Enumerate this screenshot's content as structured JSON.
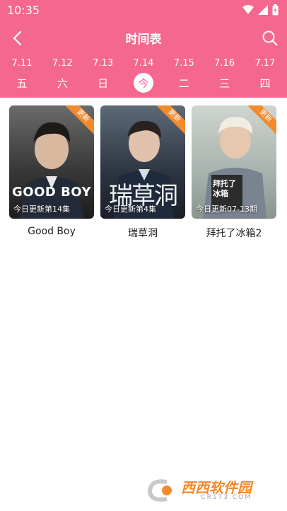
{
  "status": {
    "time": "10:35",
    "wifi_icon": "wifi-icon",
    "signal_icon": "signal-icon",
    "battery_icon": "battery-charging-icon"
  },
  "nav": {
    "title": "时间表",
    "back_icon": "back-arrow-icon",
    "search_icon": "search-icon"
  },
  "dates": [
    {
      "date": "7.11",
      "weekday": "五",
      "active": false
    },
    {
      "date": "7.12",
      "weekday": "六",
      "active": false
    },
    {
      "date": "7.13",
      "weekday": "日",
      "active": false
    },
    {
      "date": "7.14",
      "weekday": "今",
      "active": true
    },
    {
      "date": "7.15",
      "weekday": "二",
      "active": false
    },
    {
      "date": "7.16",
      "weekday": "三",
      "active": false
    },
    {
      "date": "7.17",
      "weekday": "四",
      "active": false
    }
  ],
  "shows": [
    {
      "title": "Good Boy",
      "poster_text": "GOOD BOY",
      "badge": "更新",
      "update_text": "今日更新第14集"
    },
    {
      "title": "瑞草洞",
      "poster_text": "瑞草洞",
      "badge": "更新",
      "update_text": "今日更新第4集"
    },
    {
      "title": "拜托了冰箱2",
      "poster_text": "拜托了 冰箱",
      "badge": "更新",
      "update_text": "今日更新07-13期"
    }
  ],
  "watermark": {
    "brand": "西西软件园",
    "domain": "CR173.COM"
  },
  "colors": {
    "accent": "#f4678f",
    "badge": "#f28a2e"
  }
}
